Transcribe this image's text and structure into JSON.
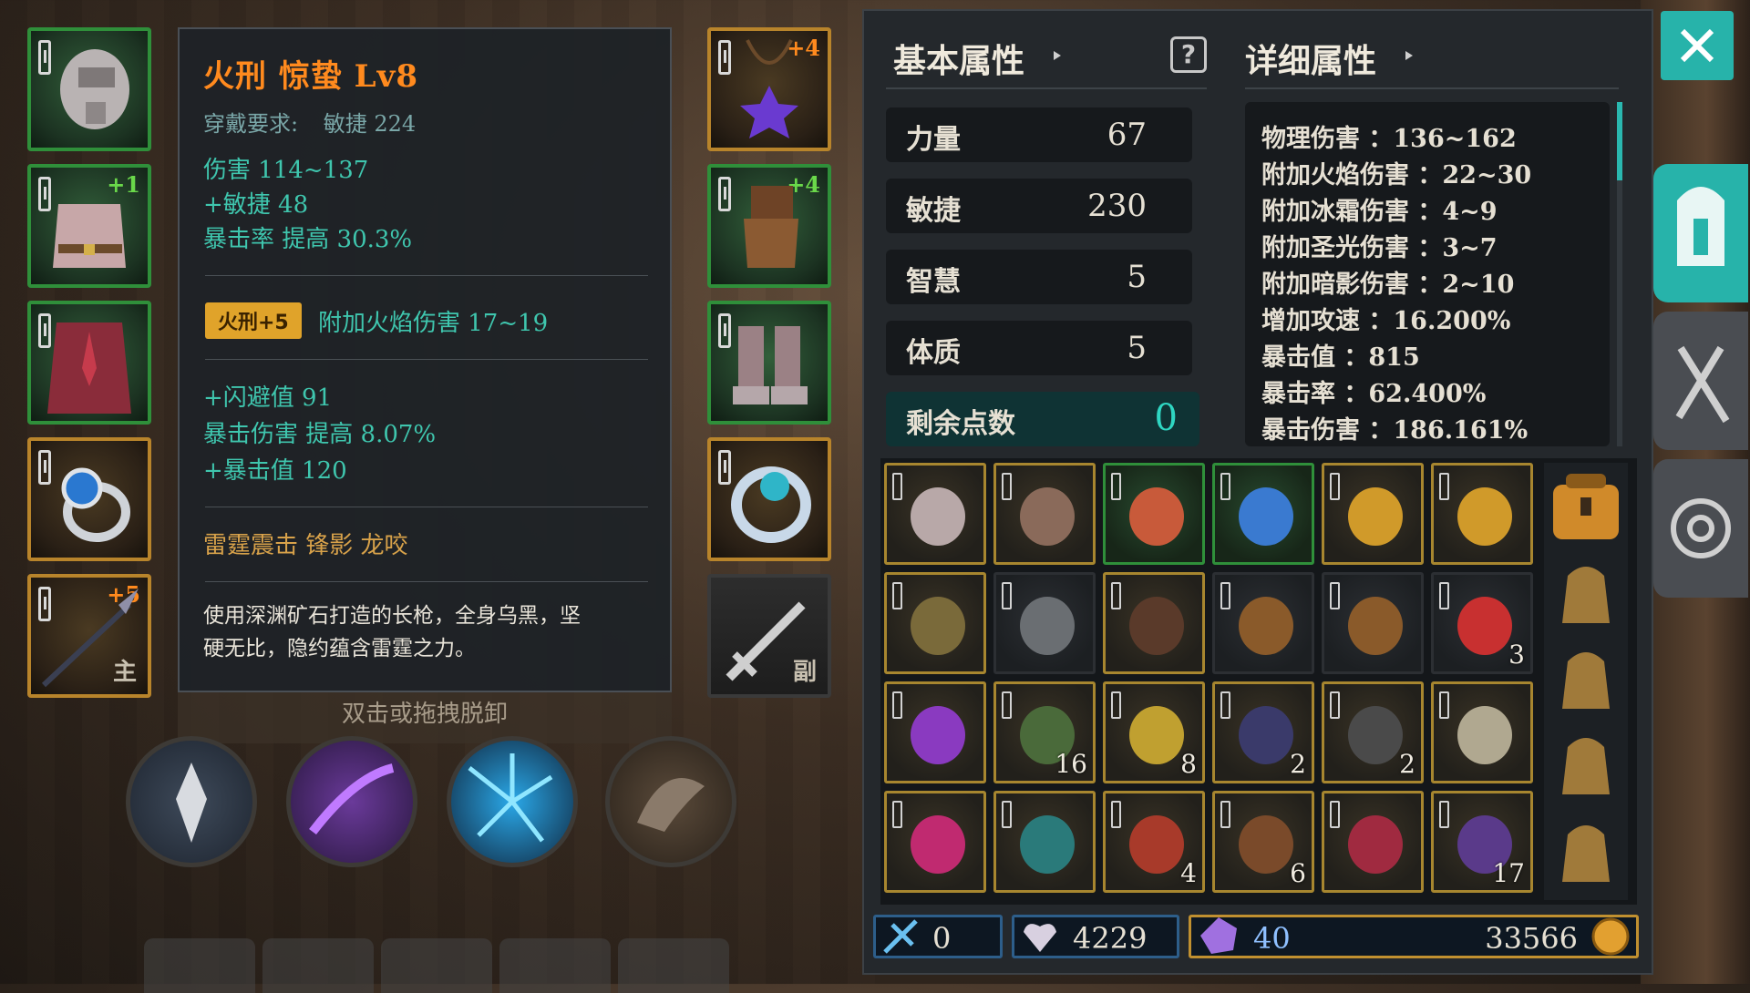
{
  "equipment_left": [
    {
      "name": "helmet",
      "border": "green",
      "plus": ""
    },
    {
      "name": "chest-armor",
      "border": "green",
      "plus": "+1"
    },
    {
      "name": "leg-armor",
      "border": "green",
      "plus": ""
    },
    {
      "name": "ring",
      "border": "gold",
      "plus": ""
    },
    {
      "name": "spear",
      "border": "gold",
      "plus": "+5",
      "tag": "主"
    }
  ],
  "equipment_right": [
    {
      "name": "necklace",
      "border": "gold",
      "plus": "+4"
    },
    {
      "name": "gloves",
      "border": "green",
      "plus": "+4"
    },
    {
      "name": "boots",
      "border": "green",
      "plus": ""
    },
    {
      "name": "ring",
      "border": "gold",
      "plus": ""
    },
    {
      "name": "offhand",
      "border": "gray",
      "plus": "",
      "tag": "副"
    }
  ],
  "tooltip": {
    "title": "火刑 惊蛰 Lv8",
    "requirement_label": "穿戴要求:",
    "requirement_value": "敏捷 224",
    "base_stats": [
      "伤害  114~137",
      "+敏捷 48",
      "暴击率 提高 30.3%"
    ],
    "gem_badge": "火刑+5",
    "gem_effect": "附加火焰伤害 17~19",
    "extra_stats": [
      "+闪避值 91",
      "暴击伤害 提高 8.07%",
      "+暴击值 120"
    ],
    "skills": "雷霆震击   锋影   龙咬",
    "description_1": "使用深渊矿石打造的长枪，全身乌黑，坚",
    "description_2": "硬无比，隐约蕴含雷霆之力。"
  },
  "hint": "双击或拖拽脱卸",
  "panel": {
    "basic_header": "基本属性",
    "detail_header": "详细属性",
    "stats": [
      {
        "label": "力量",
        "value": "67"
      },
      {
        "label": "敏捷",
        "value": "230"
      },
      {
        "label": "智慧",
        "value": "5"
      },
      {
        "label": "体质",
        "value": "5"
      }
    ],
    "remaining_label": "剩余点数",
    "remaining_value": "0",
    "details": [
      "物理伤害 ：136~162",
      "附加火焰伤害 ：22~30",
      "附加冰霜伤害 ：4~9",
      "附加圣光伤害 ：3~7",
      "附加暗影伤害 ：2~10",
      "增加攻速 ：16.200%",
      "暴击值 ：815",
      "暴击率 ：62.400%",
      "暴击伤害 ：186.161%"
    ]
  },
  "inventory": [
    {
      "item": "bow",
      "border": "g",
      "count": ""
    },
    {
      "item": "gauntlet",
      "border": "g",
      "count": ""
    },
    {
      "item": "spear",
      "border": "gr",
      "count": ""
    },
    {
      "item": "blue-ring",
      "border": "gr",
      "count": ""
    },
    {
      "item": "gold-ring",
      "border": "g",
      "count": ""
    },
    {
      "item": "gold-ring",
      "border": "g",
      "count": ""
    },
    {
      "item": "longbow",
      "border": "g",
      "count": ""
    },
    {
      "item": "iron-helm",
      "border": "n",
      "count": ""
    },
    {
      "item": "glove",
      "border": "g",
      "count": ""
    },
    {
      "item": "pouch",
      "border": "n",
      "count": ""
    },
    {
      "item": "pouch",
      "border": "n",
      "count": ""
    },
    {
      "item": "potion",
      "border": "n",
      "count": "3"
    },
    {
      "item": "purple-vase",
      "border": "g",
      "count": ""
    },
    {
      "item": "crossbow",
      "border": "g",
      "count": "16"
    },
    {
      "item": "swirl-scroll",
      "border": "g",
      "count": "8"
    },
    {
      "item": "dark-ore",
      "border": "g",
      "count": "2"
    },
    {
      "item": "coal",
      "border": "g",
      "count": "2"
    },
    {
      "item": "orb",
      "border": "g",
      "count": ""
    },
    {
      "item": "flower",
      "border": "g",
      "count": ""
    },
    {
      "item": "crystal",
      "border": "g",
      "count": ""
    },
    {
      "item": "feather",
      "border": "g",
      "count": "4"
    },
    {
      "item": "wood",
      "border": "g",
      "count": "6"
    },
    {
      "item": "meat",
      "border": "g",
      "count": ""
    },
    {
      "item": "purple-gem-ore",
      "border": "g",
      "count": "17"
    }
  ],
  "currency": {
    "fragments": "0",
    "hearts": "4229",
    "crystals": "40",
    "gold": "33566"
  },
  "colors": {
    "accent": "#27b3aa",
    "orange": "#ff8a1e",
    "green_border": "#2f8f3a",
    "gold_border": "#b8842b"
  }
}
